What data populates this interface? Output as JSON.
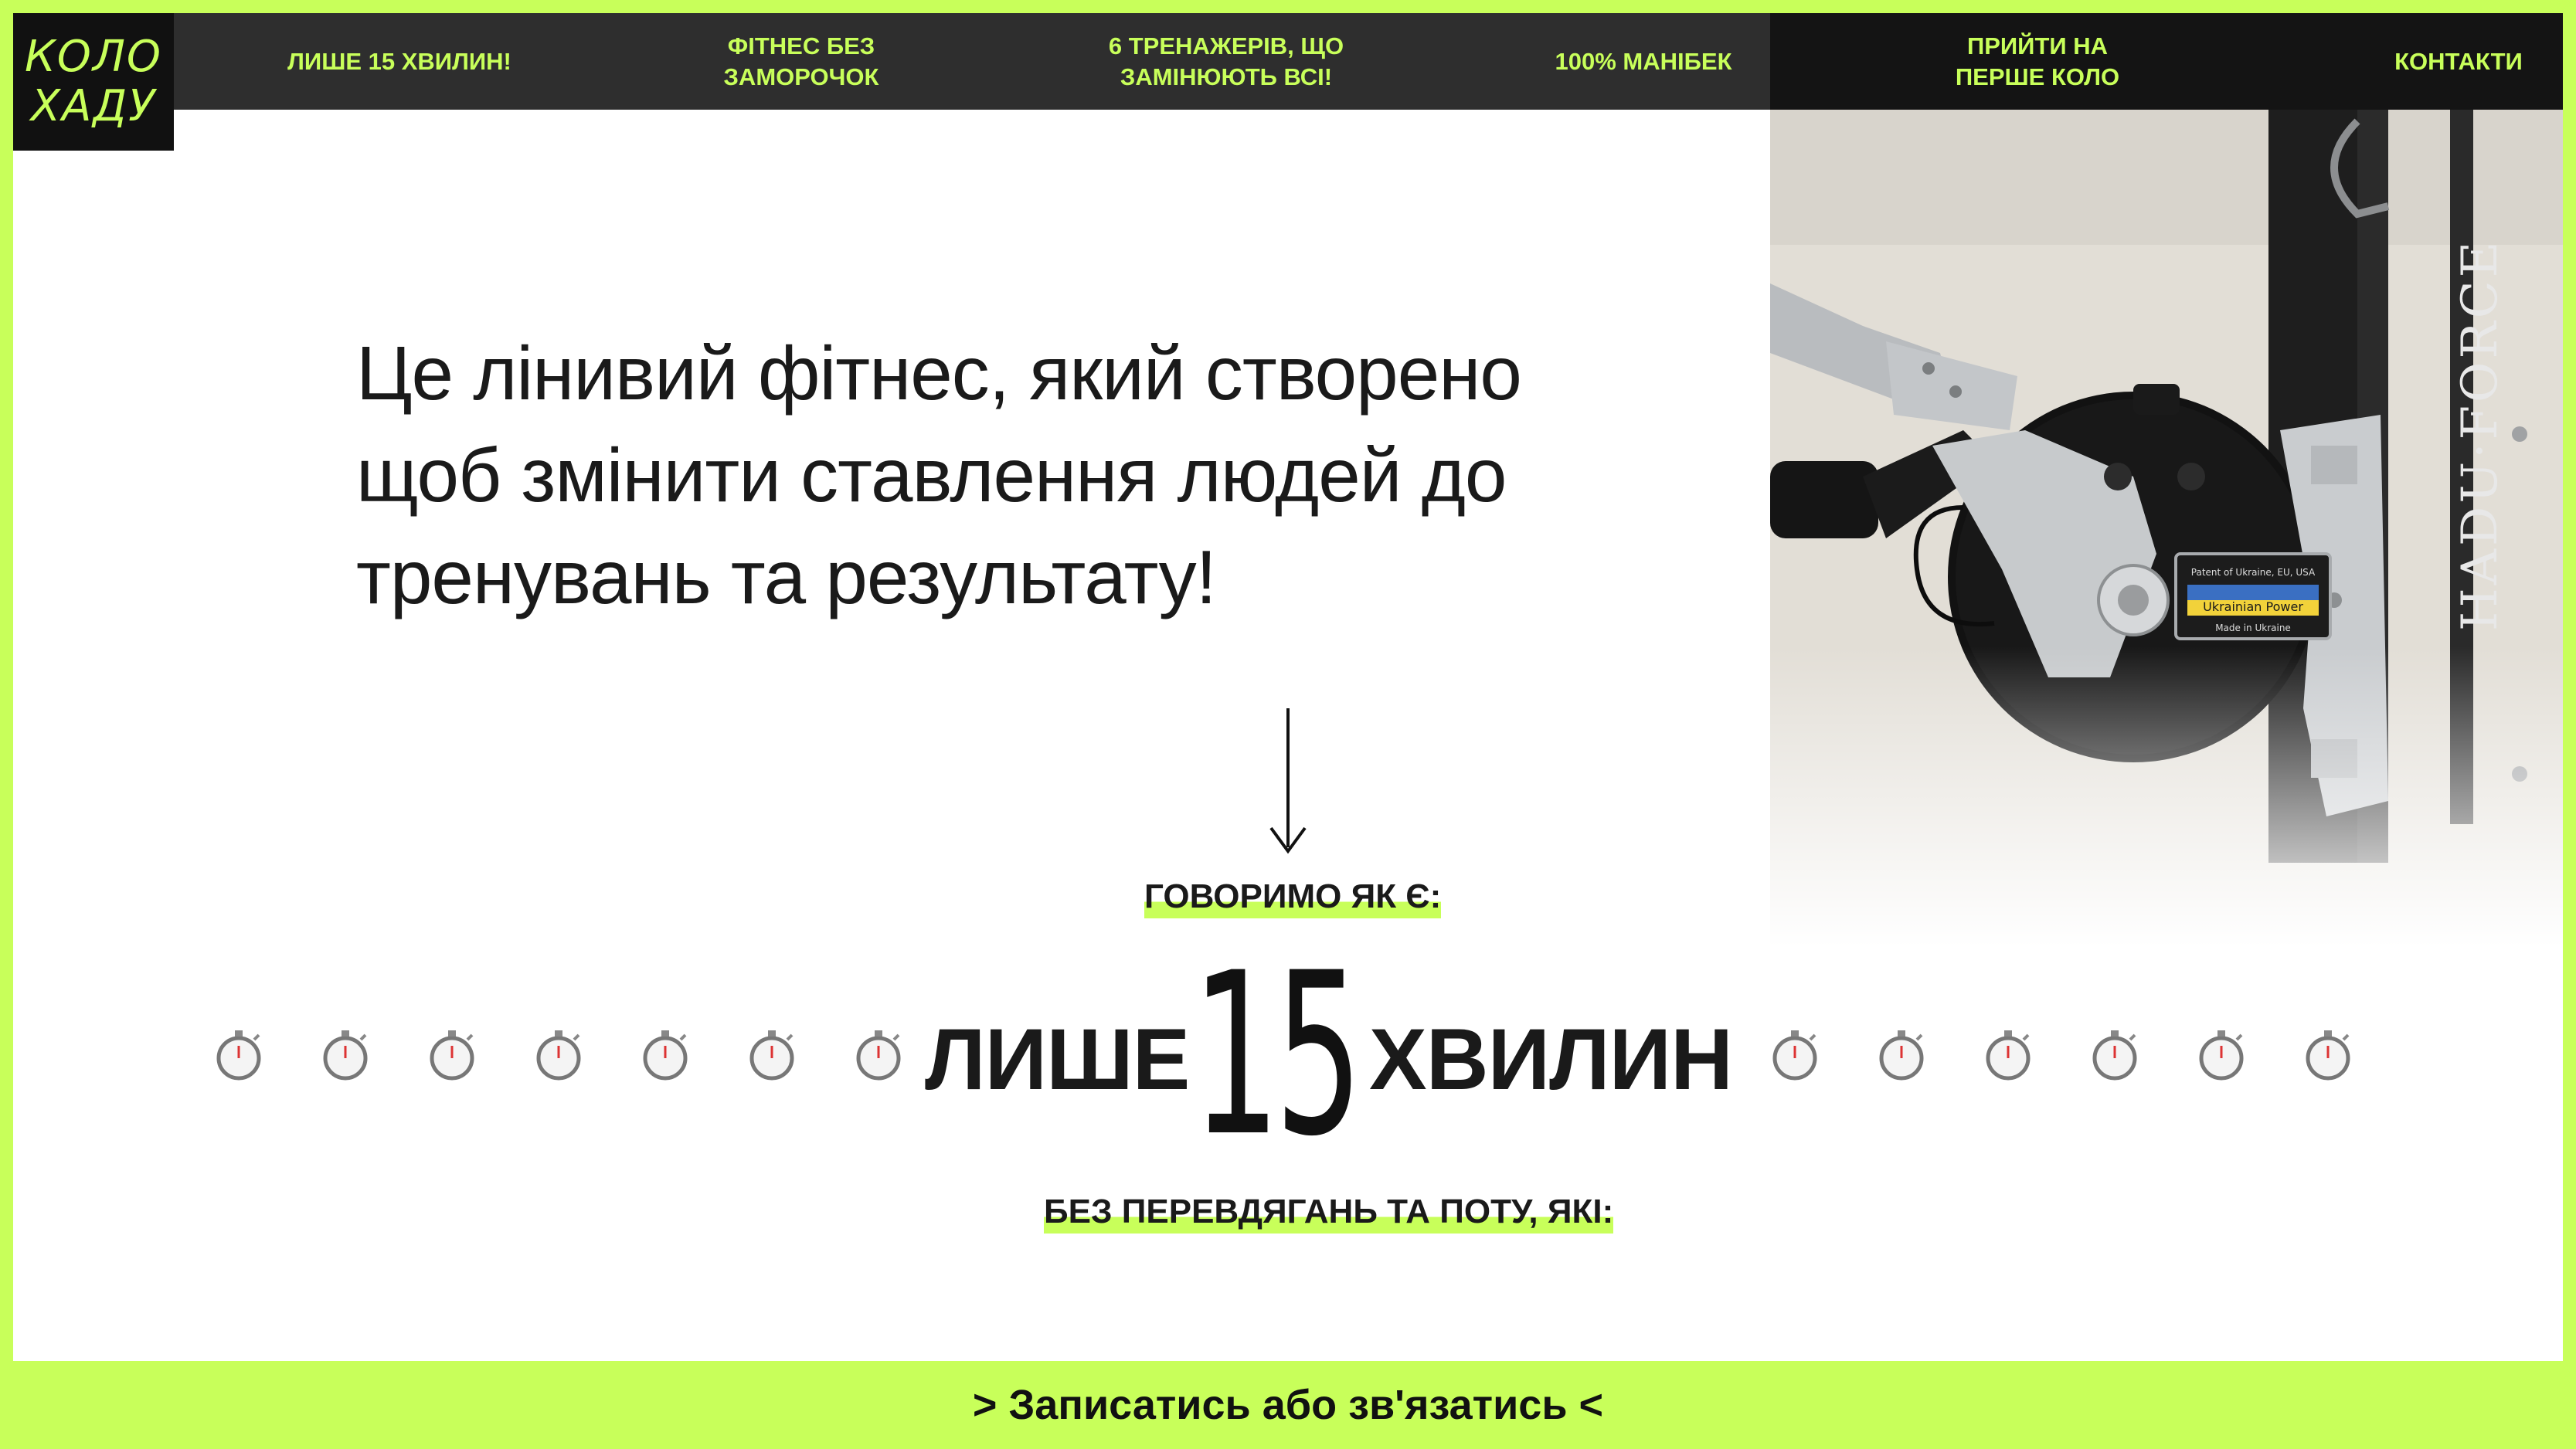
{
  "brand": {
    "logo_line1": "КОЛО",
    "logo_line2": "ХАДУ"
  },
  "nav": {
    "items": [
      {
        "label": "ЛИШЕ 15 ХВИЛИН!"
      },
      {
        "label": "ФІТНЕС БЕЗ ЗАМОРОЧОК"
      },
      {
        "label": "6 ТРЕНАЖЕРІВ, ЩО ЗАМІНЮЮТЬ ВСІ!"
      },
      {
        "label": "100% МАНІБЕК"
      },
      {
        "label": "ПРИЙТИ НА ПЕРШЕ КОЛО"
      },
      {
        "label": "КОНТАКТИ"
      }
    ]
  },
  "hero": {
    "text": "Це лінивий фітнес, який створено щоб змінити ставлення людей до тренувань та результату!",
    "kicker": "ГОВОРИМО ЯК Є:",
    "only_word": "ЛИШЕ",
    "number": "15",
    "minutes_word": "ХВИЛИН",
    "subline": "БЕЗ ПЕРЕВДЯГАНЬ ТА ПОТУ, ЯКІ:",
    "timer_icon": "stopwatch-icon"
  },
  "photo": {
    "brand_text": "HADU·FORCE",
    "plate_line1": "Patent of Ukraine, EU, USA",
    "plate_line2": "Ukrainian Power",
    "plate_line3": "Made in Ukraine"
  },
  "cta": {
    "label": "> Записатись або зв'язатись <"
  },
  "colors": {
    "accent": "#c8ff5a",
    "nav_bg": "#2e2e2e",
    "text": "#1a1a1a"
  }
}
